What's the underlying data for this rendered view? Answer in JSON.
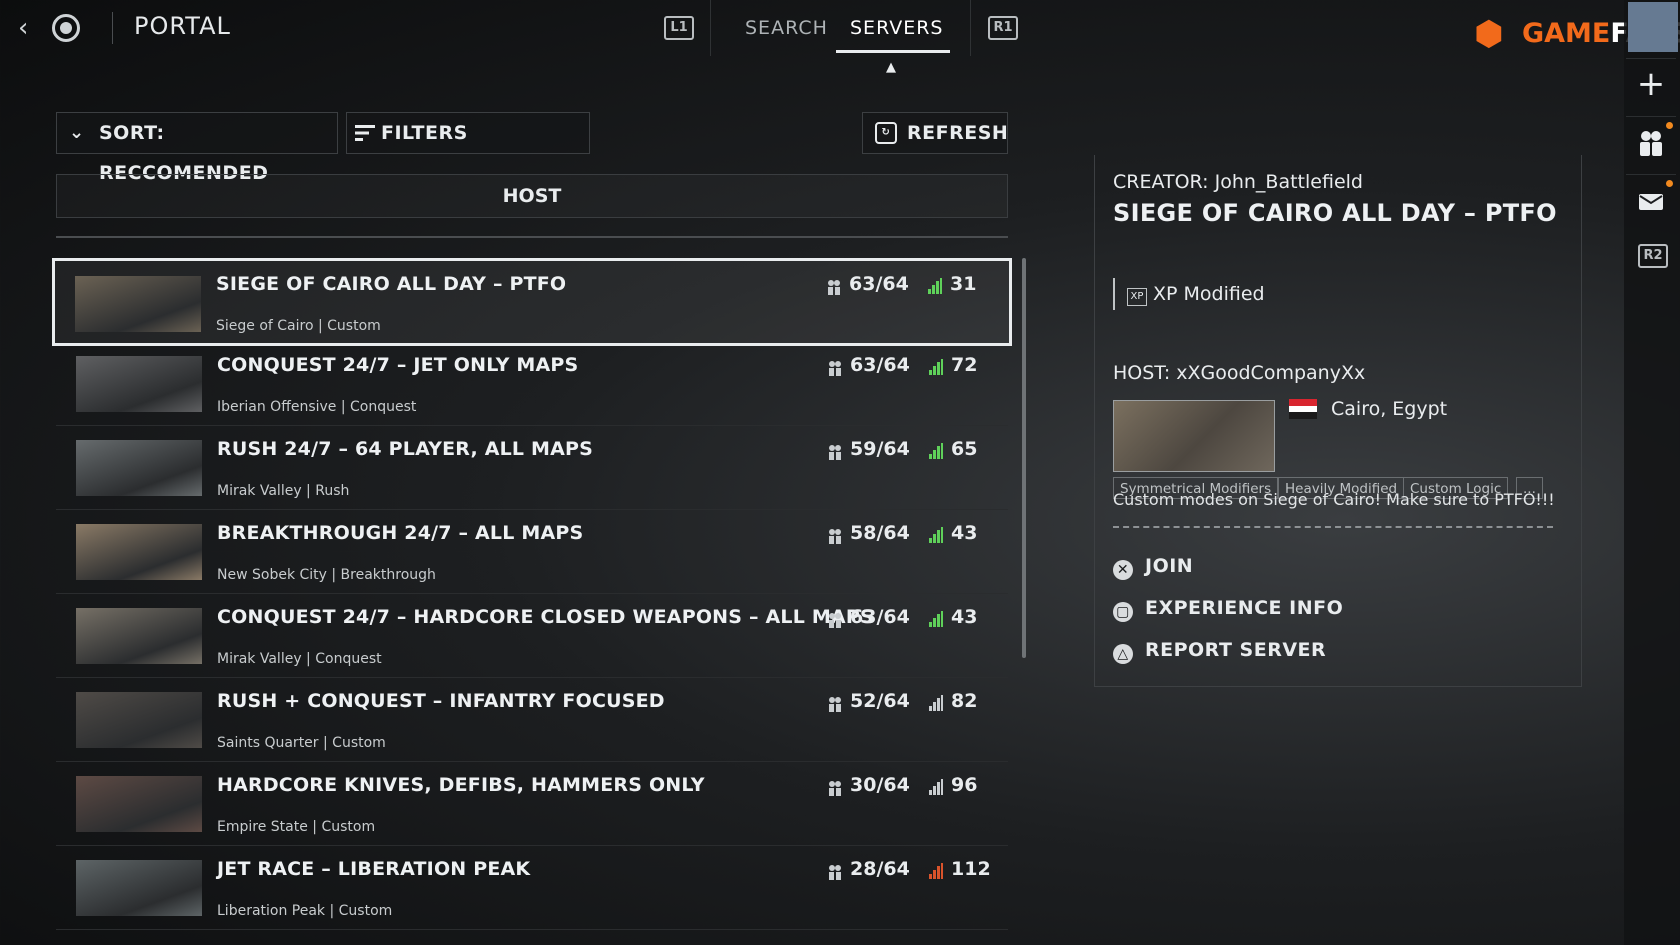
{
  "header": {
    "title": "PORTAL",
    "l1": "L1",
    "r1": "R1",
    "tabs": [
      "SEARCH",
      "SERVERS"
    ],
    "logo_game": "GAME",
    "logo_fans": "FANS"
  },
  "rail": {
    "r2": "R2"
  },
  "controls": {
    "sort_label": "SORT: RECCOMENDED",
    "filters_label": "FILTERS",
    "refresh_label": "REFRESH",
    "host_header": "HOST"
  },
  "servers": [
    {
      "title": "SIEGE OF CAIRO ALL DAY – PTFO",
      "map": "Siege of Cairo | Custom",
      "players": "63/64",
      "ping": "31",
      "ping_color": "#5fd15a",
      "thumb": "#6b6254"
    },
    {
      "title": "CONQUEST 24/7 – JET ONLY MAPS",
      "map": "Iberian Offensive | Conquest",
      "players": "63/64",
      "ping": "72",
      "ping_color": "#5fd15a",
      "thumb": "#5f6062"
    },
    {
      "title": "RUSH 24/7 – 64  PLAYER, ALL MAPS",
      "map": "Mirak Valley | Rush",
      "players": "59/64",
      "ping": "65",
      "ping_color": "#5fd15a",
      "thumb": "#666b6d"
    },
    {
      "title": "BREAKTHROUGH 24/7 – ALL MAPS",
      "map": "New Sobek City | Breakthrough",
      "players": "58/64",
      "ping": "43",
      "ping_color": "#5fd15a",
      "thumb": "#8a7a66"
    },
    {
      "title": "CONQUEST 24/7 – HARDCORE CLOSED WEAPONS – ALL MAPS",
      "map": "Mirak Valley | Conquest",
      "players": "63/64",
      "ping": "43",
      "ping_color": "#5fd15a",
      "thumb": "#767066"
    },
    {
      "title": "RUSH + CONQUEST – INFANTRY FOCUSED",
      "map": "Saints Quarter | Custom",
      "players": "52/64",
      "ping": "82",
      "ping_color": "#c9cdd0",
      "thumb": "#4f4b47"
    },
    {
      "title": "HARDCORE KNIVES, DEFIBS, HAMMERS ONLY",
      "map": "Empire State | Custom",
      "players": "30/64",
      "ping": "96",
      "ping_color": "#c9cdd0",
      "thumb": "#5d4a44"
    },
    {
      "title": "JET RACE – LIBERATION PEAK",
      "map": "Liberation Peak | Custom",
      "players": "28/64",
      "ping": "112",
      "ping_color": "#d9532b",
      "thumb": "#5d6466"
    }
  ],
  "detail": {
    "creator": "CREATOR:  John_Battlefield",
    "title": "SIEGE OF CAIRO ALL DAY – PTFO",
    "xp": "XP Modified",
    "tags": [
      "Symmetrical Modifiers",
      "Heavily Modified",
      "Custom Logic",
      "..."
    ],
    "host": "HOST:  xXGoodCompanyXx",
    "location": "Cairo, Egypt",
    "description": "Custom modes on Siege of Cairo! Make sure to PTFO!!!",
    "actions": [
      "JOIN",
      "EXPERIENCE INFO",
      "REPORT SERVER"
    ]
  }
}
